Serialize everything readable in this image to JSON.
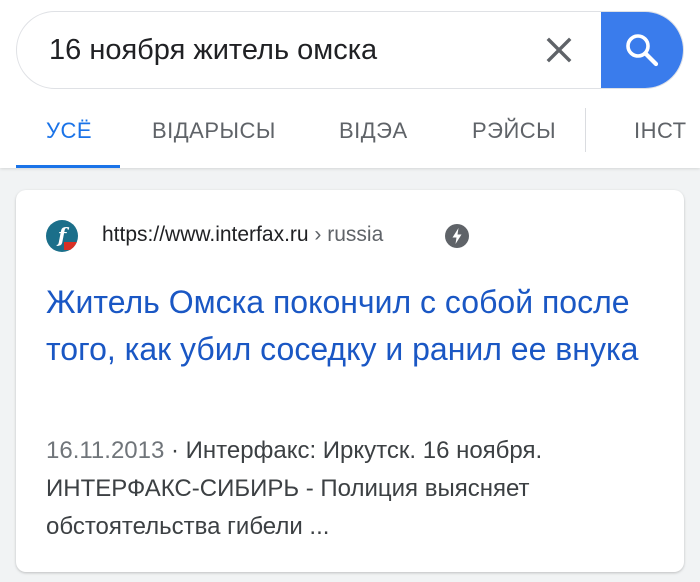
{
  "search": {
    "query": "16 ноября житель омска"
  },
  "tabs": [
    {
      "label": "УСЁ"
    },
    {
      "label": "ВІДАРЫСЫ"
    },
    {
      "label": "ВІДЭА"
    },
    {
      "label": "РЭЙСЫ"
    },
    {
      "label": "ІНСТ"
    }
  ],
  "result": {
    "url_domain": "https://www.interfax.ru",
    "url_path": " › russia",
    "favicon_letter": "f",
    "title": "Житель Омска покончил с собой после того, как убил соседку и ранил ее внука",
    "date": "16.11.2013",
    "snippet_text": " · Интерфакс: Иркутск. 16 ноября. ИНТЕРФАКС-СИБИРЬ - Полиция выясняет обстоятельства гибели ..."
  },
  "colors": {
    "accent_blue": "#1a73e8",
    "search_button": "#3a7cec",
    "link_blue": "#1a57c4",
    "favicon_bg": "#1b6f8a"
  },
  "icons": {
    "clear": "close-icon",
    "search": "search-icon",
    "amp": "amp-lightning-icon"
  }
}
